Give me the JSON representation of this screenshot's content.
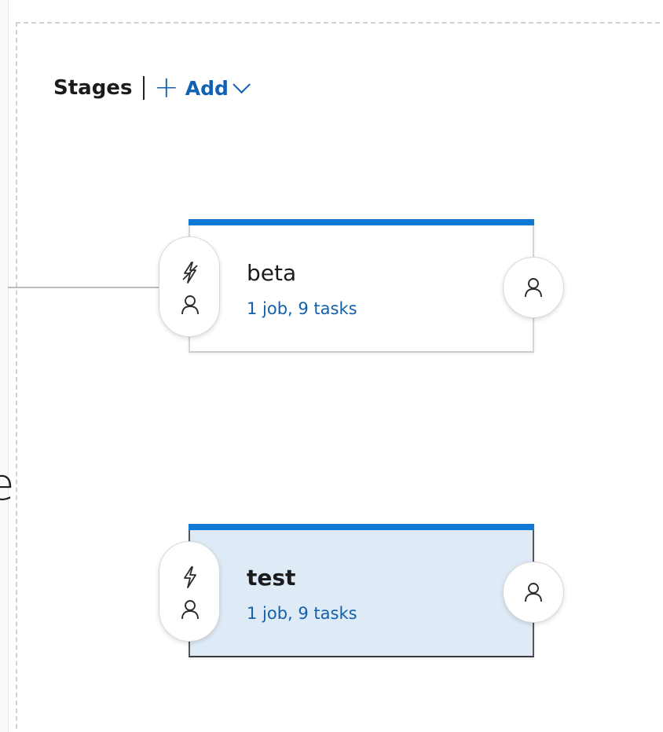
{
  "header": {
    "title": "Stages",
    "add_label": "Add",
    "add_icon": "plus-icon",
    "add_menu_icon": "chevron-down-icon"
  },
  "partial_text": "e",
  "stages": [
    {
      "name": "beta",
      "summary": "1 job, 9 tasks",
      "selected": false,
      "trigger_icon": "lightning-disabled-icon",
      "pre_approval_icon": "person-icon",
      "post_approval_icon": "person-icon"
    },
    {
      "name": "test",
      "summary": "1 job, 9 tasks",
      "selected": true,
      "trigger_icon": "lightning-icon",
      "pre_approval_icon": "person-icon",
      "post_approval_icon": "person-icon"
    }
  ],
  "colors": {
    "accent": "#0e78d5",
    "link": "#1460aa",
    "selected_bg": "#deebf7"
  }
}
